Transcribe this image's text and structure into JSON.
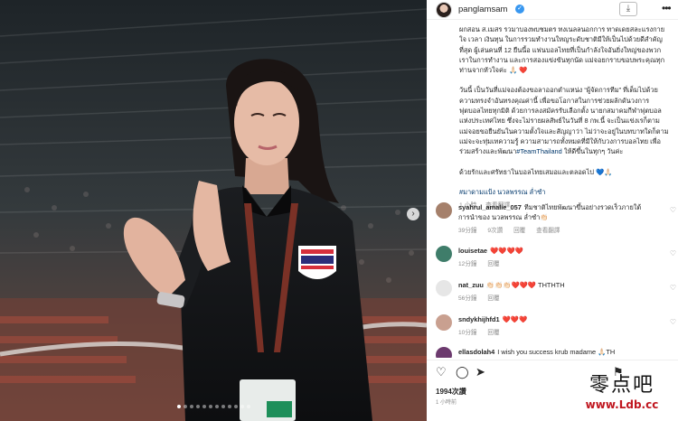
{
  "post": {
    "username": "panglamsam",
    "verified_icon": "verified-badge-icon",
    "download_icon": "download-icon",
    "more_icon": "more-options-icon",
    "caption_paragraphs": [
      "ผกสอน ส.เมสร รวมาบองพบชมตร ทงเนลลนอกการ ทาดเดยสละแรงกายใจ เวลา เงินทุน ในการรวมทำงานใหญระดับชาติมีให้เป็นไปด้วยดีสำคัญที่สุด ผู้เล่นคนที่ 12 ยืนนี้อ แฟนบอลไทยที่เป็นกำลังใจอันยิ่งใหญ่ของพวกเราในการทำงาน และการสองแข่งขันทุกนัด แม่จอยกราบขอบพระคุณทุกท่านจากหัวใจค่ะ 🙏🏻 ❤️",
      "วันนี้ เป็นวันที่แม่จองต้องขอลาออกตำแหน่ง “ผู้จัดการทีม” ที่เต็มไปด้วยความทรงจำอันทรงคุณค่านี้ เพื่อขอโอกาสในการช่วยผลักดันวงการฟุตบอลไทยทุกมิติ ด้วยการลงสมัครรับเลือกตั้ง นายกสมาคมกีฬาฟุตบอลแห่งประเทศไทย ซึ่งจะไม่รายผลสัพธ์ในวันที่ 8 กพ.นี้ จะเป็นแข่งเรก็ตาม แม่จอยขอยืนยันในความตั้งใจและสัญญาว่า ไม่ว่าจะอยู่ในบทบาทใดก็ตาม แม่จะจะทุ่มเทความรู้ ความสามารถทั้งหมดที่มีให้กับวงการบอลไทย เพื่อร่วมสร้างและพัฒนา",
      "ด้วยรักและศรัทธาในบอลไทยเสมอและตลอดไป 💙🙏🏻"
    ],
    "caption_tag_inline": "#TeamThailand",
    "caption_after_tag": " ให้ดีขึ้นในทุกๆ วันค่ะ",
    "caption_hashtags": "#มาดามแป้ง นวลพรรณ ล่ำซำ",
    "caption_time": "1 小時",
    "caption_translate": "查看翻譯"
  },
  "comments": [
    {
      "user": "syahrul_amalie_057",
      "text": "ทีมชาติไทยพัฒนาขึ้นอย่างรวดเร็วภายใต้การนำของ นวลพรรณ ล่ำซำ👏🏻",
      "time": "39分鐘",
      "likes": "9次讚",
      "reply": "回覆",
      "translate": "查看翻譯",
      "avatar_color": "#a5806b"
    },
    {
      "user": "louisetae",
      "text": "❤️❤️❤️❤️",
      "time": "12分鐘",
      "reply": "回覆",
      "avatar_color": "#3f7d6a"
    },
    {
      "user": "nat_zuu",
      "text": "👏🏻👏🏻👏🏻❤️❤️❤️ THTHTH",
      "time": "56分鐘",
      "reply": "回覆",
      "avatar_color": "#e6e6e6"
    },
    {
      "user": "sndykhijhfd1",
      "text": "❤️❤️❤️",
      "time": "10分鐘",
      "reply": "回覆",
      "avatar_color": "#c9a090"
    },
    {
      "user": "ellasdolah4",
      "text": "I wish you success krub madame 🙏🏻TH",
      "time": "",
      "reply": "",
      "avatar_color": "#6c3a6e"
    }
  ],
  "actions": {
    "like_icon": "heart-icon",
    "comment_icon": "comment-icon",
    "share_icon": "share-icon",
    "save_icon": "bookmark-icon"
  },
  "likes_count": "1994次讚",
  "posted_ago": "1 小時前",
  "watermark": {
    "cn": "零点吧",
    "url": "www.Ldb.cc"
  },
  "colors": {
    "verified": "#3897f0",
    "link": "#00376b",
    "watermark_red": "#c0161f",
    "thai_flag_blue": "#2b2d7a",
    "thai_flag_red": "#d62f3c"
  }
}
